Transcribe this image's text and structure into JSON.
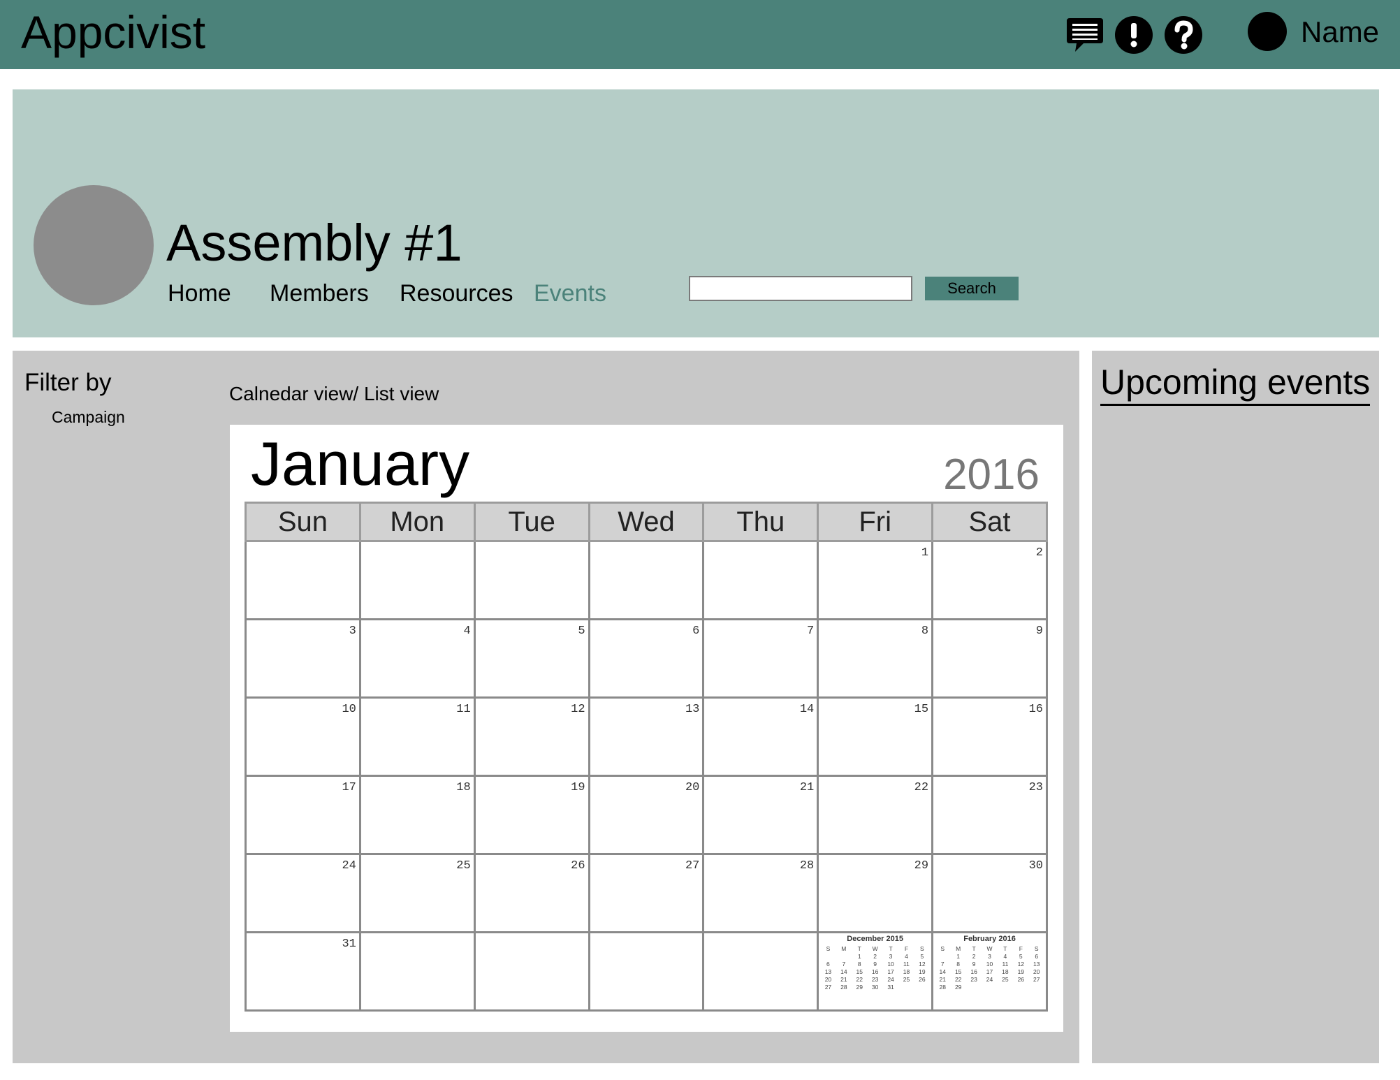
{
  "header": {
    "app_title": "Appcivist",
    "icons": [
      "chat-icon",
      "alert-icon",
      "help-icon"
    ],
    "user_name": "Name"
  },
  "assembly": {
    "title": "Assembly #1",
    "nav": [
      "Home",
      "Members",
      "Resources",
      "Events"
    ],
    "active_nav": "Events",
    "search": {
      "value": "",
      "button_label": "Search"
    }
  },
  "filter": {
    "heading": "Filter by",
    "items": [
      "Campaign"
    ]
  },
  "view_toggle": "Calnedar view/ List view",
  "calendar": {
    "month": "January",
    "year": "2016",
    "weekdays": [
      "Sun",
      "Mon",
      "Tue",
      "Wed",
      "Thu",
      "Fri",
      "Sat"
    ],
    "weeks": [
      [
        "",
        "",
        "",
        "",
        "",
        "1",
        "2"
      ],
      [
        "3",
        "4",
        "5",
        "6",
        "7",
        "8",
        "9"
      ],
      [
        "10",
        "11",
        "12",
        "13",
        "14",
        "15",
        "16"
      ],
      [
        "17",
        "18",
        "19",
        "20",
        "21",
        "22",
        "23"
      ],
      [
        "24",
        "25",
        "26",
        "27",
        "28",
        "29",
        "30"
      ],
      [
        "31",
        "",
        "",
        "",
        "",
        "",
        ""
      ]
    ],
    "mini_calendars": [
      {
        "title": "December 2015",
        "weekdays": [
          "S",
          "M",
          "T",
          "W",
          "T",
          "F",
          "S"
        ],
        "weeks": [
          [
            "",
            "",
            "1",
            "2",
            "3",
            "4",
            "5"
          ],
          [
            "6",
            "7",
            "8",
            "9",
            "10",
            "11",
            "12"
          ],
          [
            "13",
            "14",
            "15",
            "16",
            "17",
            "18",
            "19"
          ],
          [
            "20",
            "21",
            "22",
            "23",
            "24",
            "25",
            "26"
          ],
          [
            "27",
            "28",
            "29",
            "30",
            "31",
            "",
            ""
          ]
        ]
      },
      {
        "title": "February 2016",
        "weekdays": [
          "S",
          "M",
          "T",
          "W",
          "T",
          "F",
          "S"
        ],
        "weeks": [
          [
            "",
            "1",
            "2",
            "3",
            "4",
            "5",
            "6"
          ],
          [
            "7",
            "8",
            "9",
            "10",
            "11",
            "12",
            "13"
          ],
          [
            "14",
            "15",
            "16",
            "17",
            "18",
            "19",
            "20"
          ],
          [
            "21",
            "22",
            "23",
            "24",
            "25",
            "26",
            "27"
          ],
          [
            "28",
            "29",
            "",
            "",
            "",
            "",
            ""
          ]
        ]
      }
    ]
  },
  "sidebar": {
    "title": "Upcoming events"
  },
  "colors": {
    "topbar": "#4b827a",
    "banner": "#b5cdc7",
    "panel": "#c8c8c8",
    "active_nav": "#4b827a",
    "avatar": "#8c8c8c"
  }
}
